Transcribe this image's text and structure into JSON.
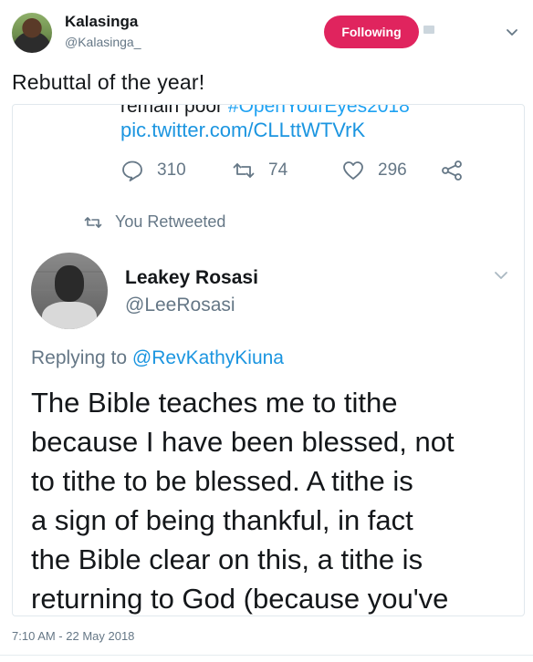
{
  "author": {
    "name": "Kalasinga",
    "handle": "@Kalasinga_",
    "follow_label": "Following"
  },
  "tweet": {
    "text": "Rebuttal of the year!",
    "timestamp": "7:10 AM - 22 May 2018"
  },
  "embedded": {
    "cut_text_dark": "remain poor",
    "cut_text_link": " #OpenYourEyes2018",
    "pic_link": "pic.twitter.com/CLLttWTVrK",
    "reply_count": "310",
    "retweet_count": "74",
    "like_count": "296",
    "retweeted_label": "You Retweeted",
    "quote": {
      "name": "Leakey Rosasi",
      "handle": "@LeeRosasi",
      "replying_prefix": "Replying to ",
      "replying_mention": "@RevKathyKiuna",
      "lines": [
        "The Bible teaches me to tithe",
        "because I have been blessed, not",
        "to tithe to be blessed. A tithe is",
        "a sign of being thankful, in fact",
        "the Bible clear on this, a tithe is",
        "returning to God (because you've"
      ]
    }
  },
  "colors": {
    "follow_bg": "#e0245e",
    "link": "#1b95e0",
    "muted": "#657786"
  }
}
